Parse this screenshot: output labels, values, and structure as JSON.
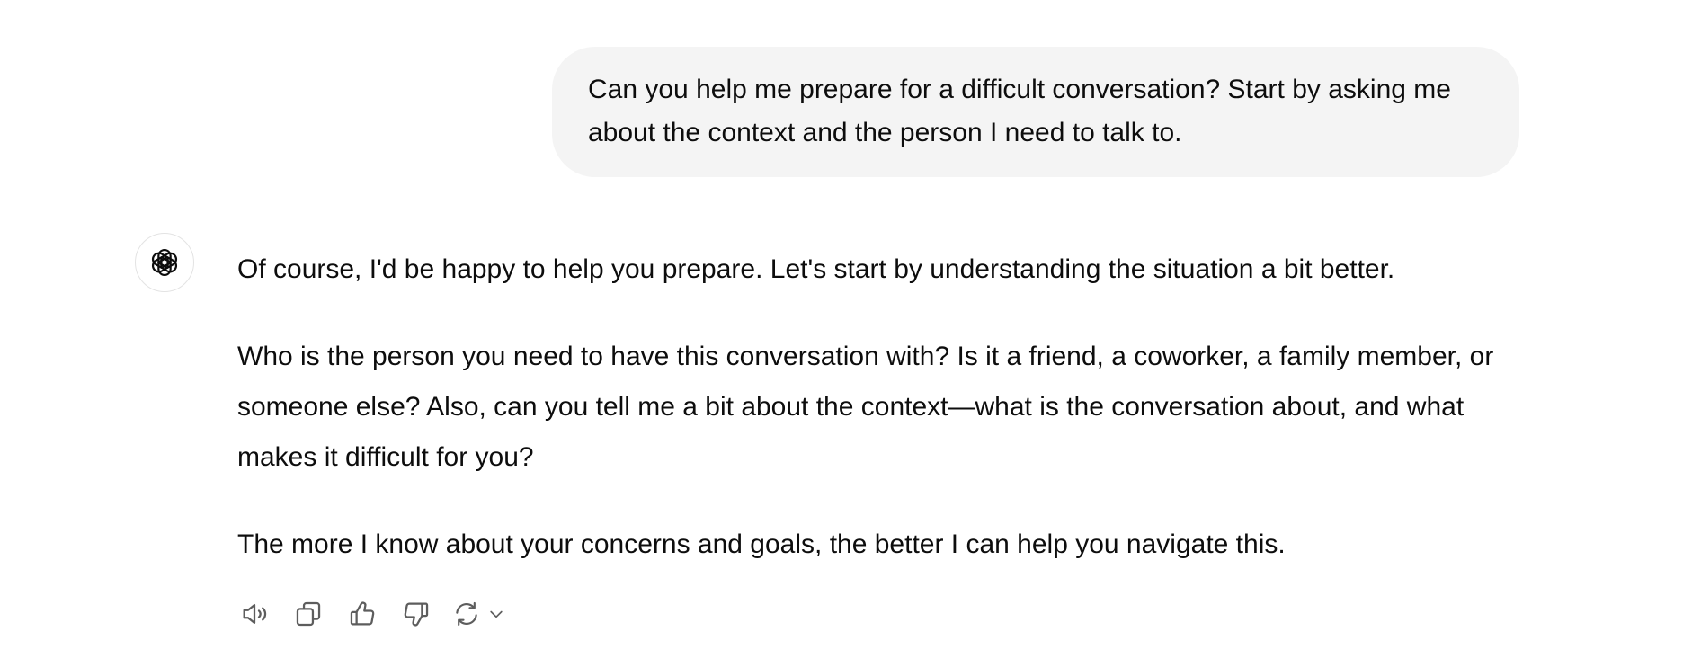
{
  "conversation": {
    "user_message": "Can you help me prepare for a difficult conversation? Start by asking me about the context and the person I need to talk to.",
    "assistant_paragraphs": [
      "Of course, I'd be happy to help you prepare. Let's start by understanding the situation a bit better.",
      "Who is the person you need to have this conversation with? Is it a friend, a coworker, a family member, or someone else? Also, can you tell me a bit about the context—what is the conversation about, and what makes it difficult for you?",
      "The more I know about your concerns and goals, the better I can help you navigate this."
    ]
  },
  "assistant_avatar": {
    "icon": "openai-logo-icon"
  },
  "actions": {
    "read_aloud_icon": "speaker-icon",
    "copy_icon": "copy-icon",
    "good_response_icon": "thumbs-up-icon",
    "bad_response_icon": "thumbs-down-icon",
    "regenerate_icon": "refresh-icon",
    "regenerate_menu_icon": "chevron-down-icon"
  },
  "colors": {
    "user_bubble_bg": "#f4f4f4",
    "text": "#0d0d0d",
    "icon": "#5d5d5d"
  }
}
